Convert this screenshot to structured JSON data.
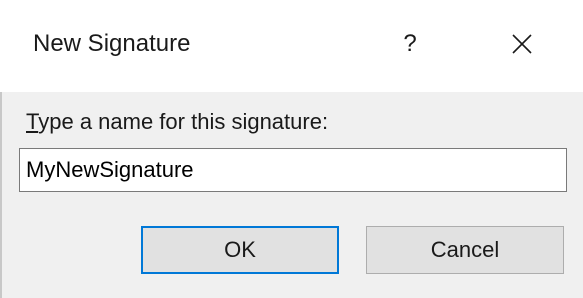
{
  "dialog": {
    "title": "New Signature",
    "help_label": "?",
    "close_label": "close"
  },
  "form": {
    "prompt_accel": "T",
    "prompt_rest": "ype a name for this signature:",
    "name_value": "MyNewSignature"
  },
  "buttons": {
    "ok_label": "OK",
    "cancel_label": "Cancel"
  },
  "icons": {
    "close": "close-icon"
  },
  "colors": {
    "accent": "#0078d7",
    "body_bg": "#f0f0f0",
    "button_bg": "#e1e1e1"
  }
}
